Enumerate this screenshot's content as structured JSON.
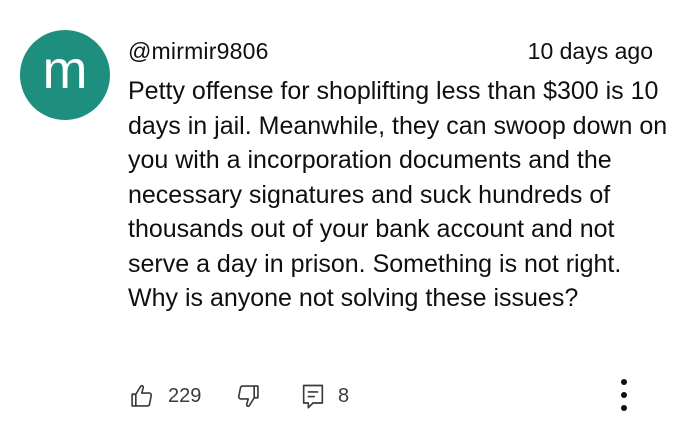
{
  "comment": {
    "avatar_letter": "m",
    "avatar_color": "#1e8e7e",
    "username": "@mirmir9806",
    "timestamp": "10 days ago",
    "text": "Petty offense for shoplifting less than $300 is 10 days in jail. Meanwhile, they can swoop down on you with a incorporation documents and the necessary signatures and suck hundreds of thousands out of your bank account and not serve a day in prison. Something is not right. Why is anyone not solving these issues?"
  },
  "actions": {
    "like_icon": "thumbs-up-icon",
    "like_count": "229",
    "dislike_icon": "thumbs-down-icon",
    "reply_icon": "comment-icon",
    "reply_count": "8",
    "more_icon": "more-vertical-icon"
  }
}
